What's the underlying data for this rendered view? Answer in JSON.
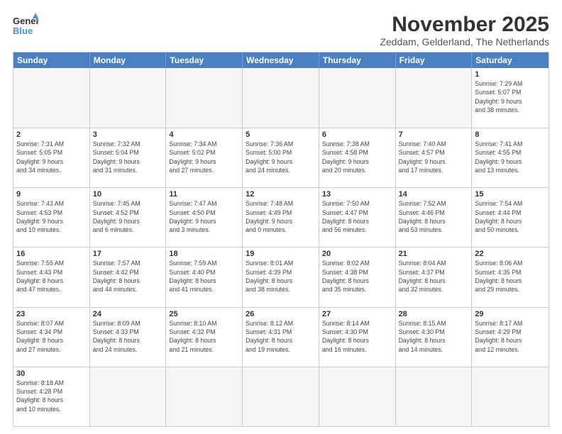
{
  "logo": {
    "line1": "General",
    "line2": "Blue"
  },
  "title": "November 2025",
  "subtitle": "Zeddam, Gelderland, The Netherlands",
  "days": [
    "Sunday",
    "Monday",
    "Tuesday",
    "Wednesday",
    "Thursday",
    "Friday",
    "Saturday"
  ],
  "weeks": [
    [
      {
        "day": "",
        "info": ""
      },
      {
        "day": "",
        "info": ""
      },
      {
        "day": "",
        "info": ""
      },
      {
        "day": "",
        "info": ""
      },
      {
        "day": "",
        "info": ""
      },
      {
        "day": "",
        "info": ""
      },
      {
        "day": "1",
        "info": "Sunrise: 7:29 AM\nSunset: 5:07 PM\nDaylight: 9 hours\nand 38 minutes."
      }
    ],
    [
      {
        "day": "2",
        "info": "Sunrise: 7:31 AM\nSunset: 5:05 PM\nDaylight: 9 hours\nand 34 minutes."
      },
      {
        "day": "3",
        "info": "Sunrise: 7:32 AM\nSunset: 5:04 PM\nDaylight: 9 hours\nand 31 minutes."
      },
      {
        "day": "4",
        "info": "Sunrise: 7:34 AM\nSunset: 5:02 PM\nDaylight: 9 hours\nand 27 minutes."
      },
      {
        "day": "5",
        "info": "Sunrise: 7:36 AM\nSunset: 5:00 PM\nDaylight: 9 hours\nand 24 minutes."
      },
      {
        "day": "6",
        "info": "Sunrise: 7:38 AM\nSunset: 4:58 PM\nDaylight: 9 hours\nand 20 minutes."
      },
      {
        "day": "7",
        "info": "Sunrise: 7:40 AM\nSunset: 4:57 PM\nDaylight: 9 hours\nand 17 minutes."
      },
      {
        "day": "8",
        "info": "Sunrise: 7:41 AM\nSunset: 4:55 PM\nDaylight: 9 hours\nand 13 minutes."
      }
    ],
    [
      {
        "day": "9",
        "info": "Sunrise: 7:43 AM\nSunset: 4:53 PM\nDaylight: 9 hours\nand 10 minutes."
      },
      {
        "day": "10",
        "info": "Sunrise: 7:45 AM\nSunset: 4:52 PM\nDaylight: 9 hours\nand 6 minutes."
      },
      {
        "day": "11",
        "info": "Sunrise: 7:47 AM\nSunset: 4:50 PM\nDaylight: 9 hours\nand 3 minutes."
      },
      {
        "day": "12",
        "info": "Sunrise: 7:48 AM\nSunset: 4:49 PM\nDaylight: 9 hours\nand 0 minutes."
      },
      {
        "day": "13",
        "info": "Sunrise: 7:50 AM\nSunset: 4:47 PM\nDaylight: 8 hours\nand 56 minutes."
      },
      {
        "day": "14",
        "info": "Sunrise: 7:52 AM\nSunset: 4:46 PM\nDaylight: 8 hours\nand 53 minutes."
      },
      {
        "day": "15",
        "info": "Sunrise: 7:54 AM\nSunset: 4:44 PM\nDaylight: 8 hours\nand 50 minutes."
      }
    ],
    [
      {
        "day": "16",
        "info": "Sunrise: 7:55 AM\nSunset: 4:43 PM\nDaylight: 8 hours\nand 47 minutes."
      },
      {
        "day": "17",
        "info": "Sunrise: 7:57 AM\nSunset: 4:42 PM\nDaylight: 8 hours\nand 44 minutes."
      },
      {
        "day": "18",
        "info": "Sunrise: 7:59 AM\nSunset: 4:40 PM\nDaylight: 8 hours\nand 41 minutes."
      },
      {
        "day": "19",
        "info": "Sunrise: 8:01 AM\nSunset: 4:39 PM\nDaylight: 8 hours\nand 38 minutes."
      },
      {
        "day": "20",
        "info": "Sunrise: 8:02 AM\nSunset: 4:38 PM\nDaylight: 8 hours\nand 35 minutes."
      },
      {
        "day": "21",
        "info": "Sunrise: 8:04 AM\nSunset: 4:37 PM\nDaylight: 8 hours\nand 32 minutes."
      },
      {
        "day": "22",
        "info": "Sunrise: 8:06 AM\nSunset: 4:35 PM\nDaylight: 8 hours\nand 29 minutes."
      }
    ],
    [
      {
        "day": "23",
        "info": "Sunrise: 8:07 AM\nSunset: 4:34 PM\nDaylight: 8 hours\nand 27 minutes."
      },
      {
        "day": "24",
        "info": "Sunrise: 8:09 AM\nSunset: 4:33 PM\nDaylight: 8 hours\nand 24 minutes."
      },
      {
        "day": "25",
        "info": "Sunrise: 8:10 AM\nSunset: 4:32 PM\nDaylight: 8 hours\nand 21 minutes."
      },
      {
        "day": "26",
        "info": "Sunrise: 8:12 AM\nSunset: 4:31 PM\nDaylight: 8 hours\nand 19 minutes."
      },
      {
        "day": "27",
        "info": "Sunrise: 8:14 AM\nSunset: 4:30 PM\nDaylight: 8 hours\nand 16 minutes."
      },
      {
        "day": "28",
        "info": "Sunrise: 8:15 AM\nSunset: 4:30 PM\nDaylight: 8 hours\nand 14 minutes."
      },
      {
        "day": "29",
        "info": "Sunrise: 8:17 AM\nSunset: 4:29 PM\nDaylight: 8 hours\nand 12 minutes."
      }
    ],
    [
      {
        "day": "30",
        "info": "Sunrise: 8:18 AM\nSunset: 4:28 PM\nDaylight: 8 hours\nand 10 minutes."
      },
      {
        "day": "",
        "info": ""
      },
      {
        "day": "",
        "info": ""
      },
      {
        "day": "",
        "info": ""
      },
      {
        "day": "",
        "info": ""
      },
      {
        "day": "",
        "info": ""
      },
      {
        "day": "",
        "info": ""
      }
    ]
  ]
}
